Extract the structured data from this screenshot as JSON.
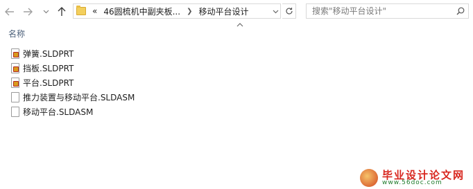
{
  "address": {
    "overflow_label": "«",
    "crumbs": [
      {
        "label": "46圆梳机中副夹板..."
      },
      {
        "label": "移动平台设计"
      }
    ]
  },
  "search": {
    "placeholder": "搜索\"移动平台设计\""
  },
  "columns": {
    "name_header": "名称"
  },
  "files": [
    {
      "name": "弹簧.SLDPRT",
      "icon": "sldprt-file-icon"
    },
    {
      "name": "挡板.SLDPRT",
      "icon": "sldprt-file-icon"
    },
    {
      "name": "平台.SLDPRT",
      "icon": "sldprt-file-icon"
    },
    {
      "name": "推力装置与移动平台.SLDASM",
      "icon": "sldasm-file-icon"
    },
    {
      "name": "移动平台.SLDASM",
      "icon": "sldasm-file-icon"
    }
  ],
  "watermark": {
    "title": "毕业设计论文网",
    "url": "www.56doc.com"
  }
}
